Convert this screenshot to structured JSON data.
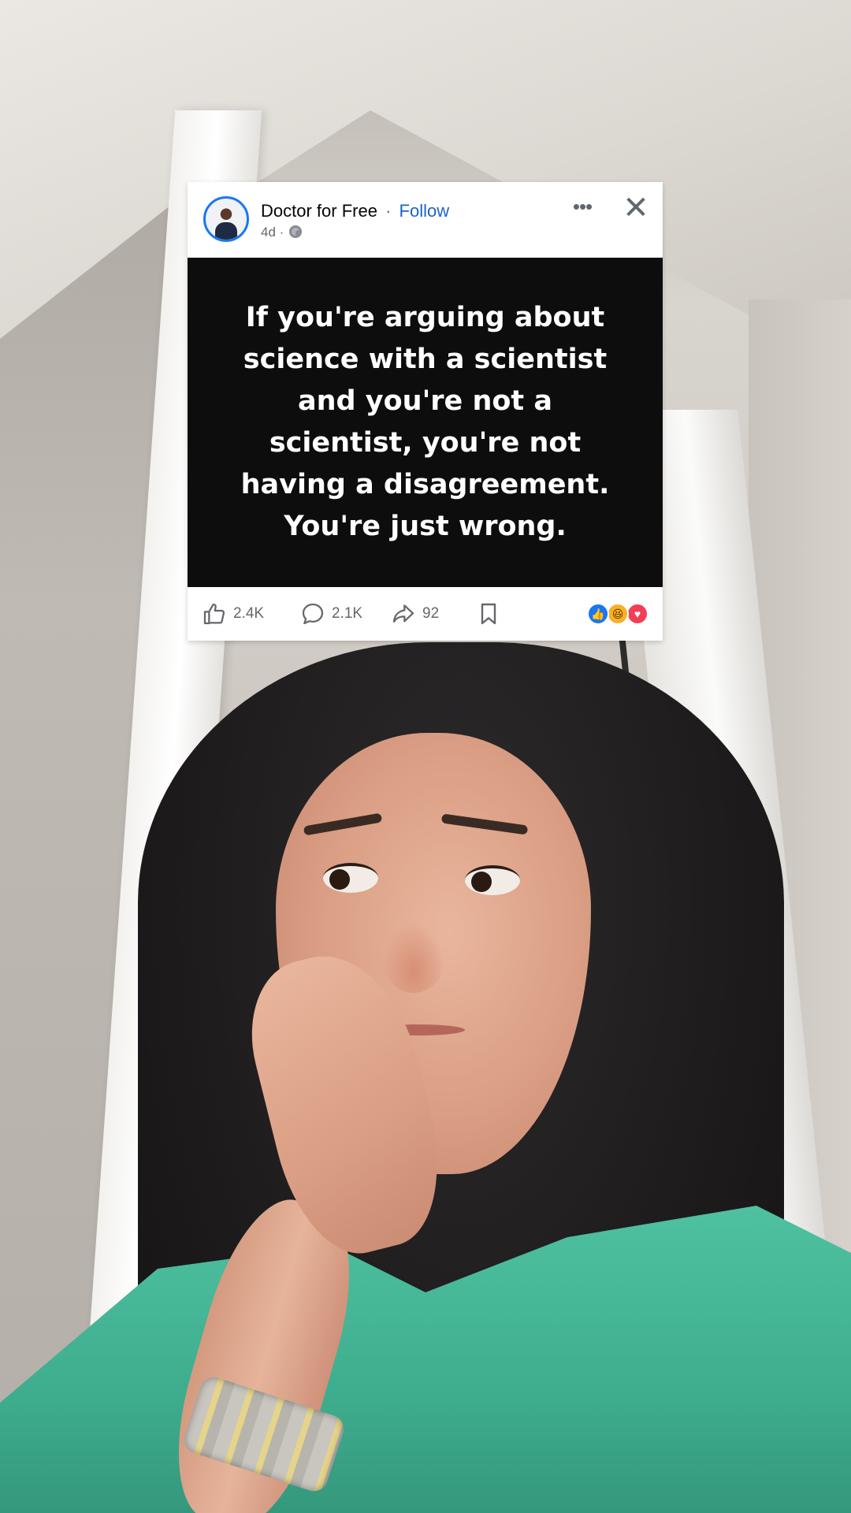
{
  "post": {
    "author": "Doctor for Free",
    "separator": "·",
    "follow_label": "Follow",
    "age": "4d",
    "meta_separator": "·",
    "privacy_icon": "globe-icon",
    "more_label": "•••",
    "close_label": "✕",
    "image_text": "If you're arguing about\nscience with a scientist\nand you're not a\nscientist, you're not\nhaving a disagreement.\nYou're just wrong."
  },
  "actions": {
    "likes": "2.4K",
    "comments": "2.1K",
    "shares": "92"
  },
  "reactions": [
    {
      "name": "like-reaction-icon",
      "glyph": "👍",
      "color": "#1877f2"
    },
    {
      "name": "haha-reaction-icon",
      "glyph": "😆",
      "color": "#f7b125"
    },
    {
      "name": "love-reaction-icon",
      "glyph": "♥",
      "color": "#f33e58"
    }
  ],
  "colors": {
    "follow": "#1a63c9",
    "image_background": "#0d0d0d",
    "shirt": "#3fae8f"
  }
}
